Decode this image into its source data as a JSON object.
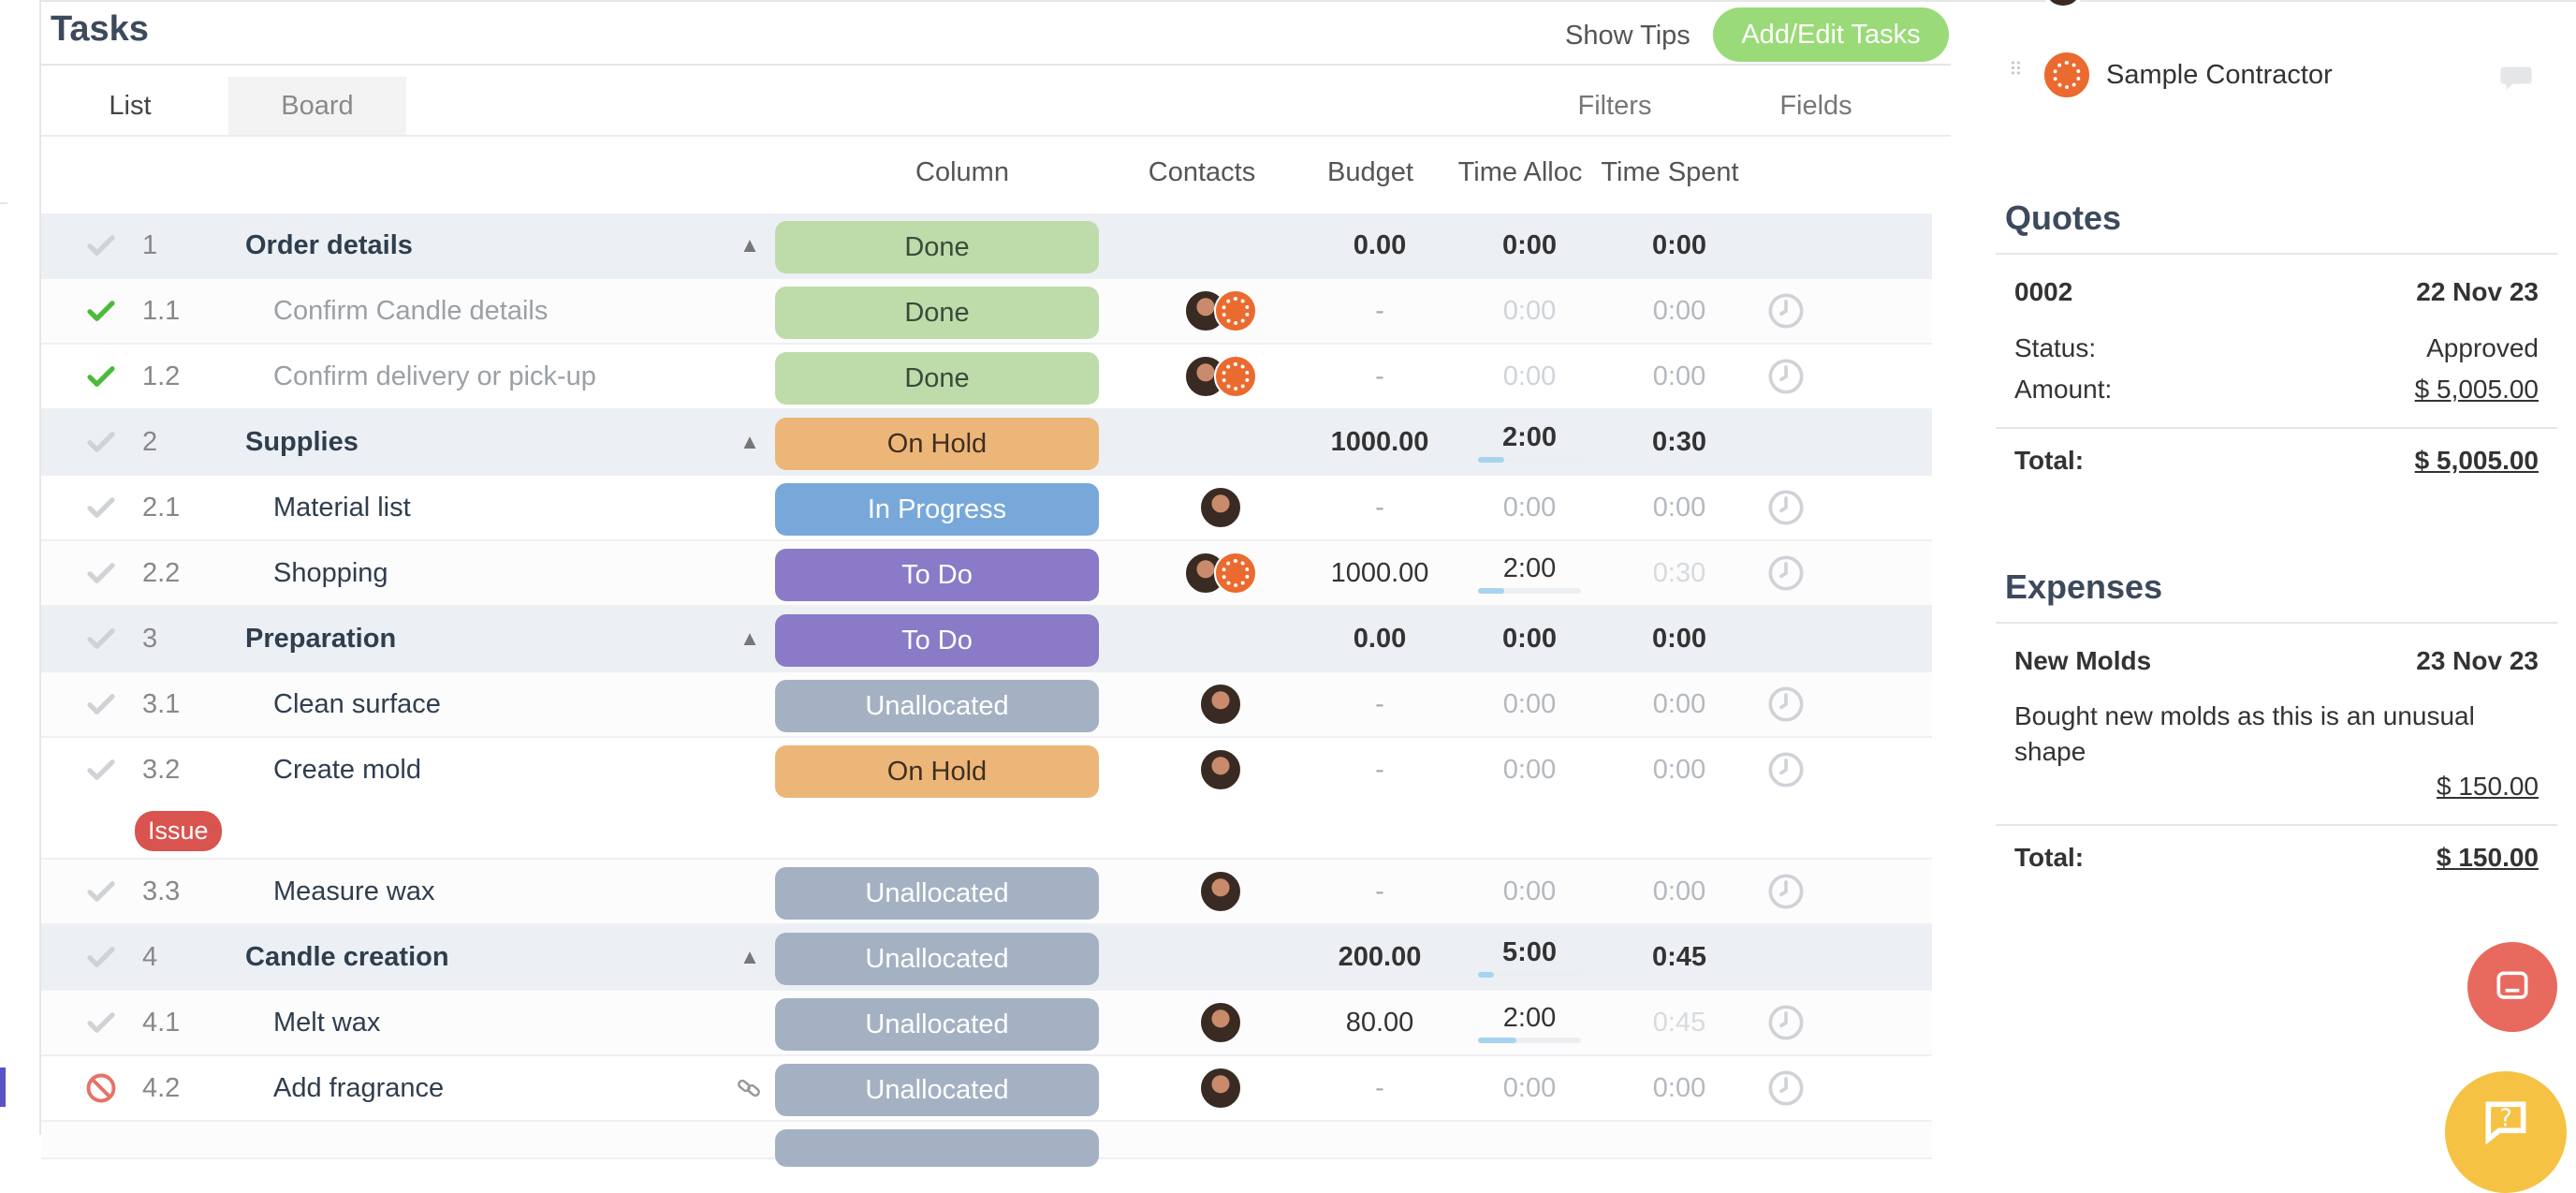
{
  "header": {
    "title": "Tasks",
    "show_tips": "Show Tips",
    "add_edit": "Add/Edit Tasks"
  },
  "tabs": {
    "list": "List",
    "board": "Board",
    "filters": "Filters",
    "fields": "Fields"
  },
  "columns": {
    "column": "Column",
    "contacts": "Contacts",
    "budget": "Budget",
    "time_alloc": "Time Alloc",
    "time_spent": "Time Spent"
  },
  "rows": [
    {
      "num": "1",
      "name": "Order details",
      "status": "Done",
      "budget": "0.00",
      "alloc": "0:00",
      "spent": "0:00"
    },
    {
      "num": "1.1",
      "name": "Confirm Candle details",
      "status": "Done",
      "budget": "-",
      "alloc": "0:00",
      "spent": "0:00"
    },
    {
      "num": "1.2",
      "name": "Confirm delivery or pick-up",
      "status": "Done",
      "budget": "-",
      "alloc": "0:00",
      "spent": "0:00"
    },
    {
      "num": "2",
      "name": "Supplies",
      "status": "On Hold",
      "budget": "1000.00",
      "alloc": "2:00",
      "spent": "0:30",
      "progress": 0.25
    },
    {
      "num": "2.1",
      "name": "Material list",
      "status": "In Progress",
      "budget": "-",
      "alloc": "0:00",
      "spent": "0:00"
    },
    {
      "num": "2.2",
      "name": "Shopping",
      "status": "To Do",
      "budget": "1000.00",
      "alloc": "2:00",
      "spent": "0:30",
      "progress": 0.25
    },
    {
      "num": "3",
      "name": "Preparation",
      "status": "To Do",
      "budget": "0.00",
      "alloc": "0:00",
      "spent": "0:00"
    },
    {
      "num": "3.1",
      "name": "Clean surface",
      "status": "Unallocated",
      "budget": "-",
      "alloc": "0:00",
      "spent": "0:00"
    },
    {
      "num": "3.2",
      "name": "Create mold",
      "status": "On Hold",
      "budget": "-",
      "alloc": "0:00",
      "spent": "0:00",
      "badge": "Issue"
    },
    {
      "num": "3.3",
      "name": "Measure wax",
      "status": "Unallocated",
      "budget": "-",
      "alloc": "0:00",
      "spent": "0:00"
    },
    {
      "num": "4",
      "name": "Candle creation",
      "status": "Unallocated",
      "budget": "200.00",
      "alloc": "5:00",
      "spent": "0:45",
      "progress": 0.15
    },
    {
      "num": "4.1",
      "name": "Melt wax",
      "status": "Unallocated",
      "budget": "80.00",
      "alloc": "2:00",
      "spent": "0:45",
      "progress": 0.375
    },
    {
      "num": "4.2",
      "name": "Add fragrance",
      "status": "Unallocated",
      "budget": "-",
      "alloc": "0:00",
      "spent": "0:00"
    }
  ],
  "contractor": {
    "name": "Sample Contractor"
  },
  "quotes": {
    "title": "Quotes",
    "number": "0002",
    "date": "22 Nov 23",
    "status_label": "Status:",
    "status_value": "Approved",
    "amount_label": "Amount:",
    "amount_value": "$ 5,005.00",
    "total_label": "Total:",
    "total_value": "$ 5,005.00"
  },
  "expenses": {
    "title": "Expenses",
    "name": "New Molds",
    "date": "23 Nov 23",
    "description": "Bought new molds as this is an unusual shape",
    "amount": "$ 150.00",
    "total_label": "Total:",
    "total_value": "$ 150.00"
  },
  "colors": {
    "done": "#bedcaa",
    "on_hold": "#edb679",
    "in_progress": "#78a8da",
    "to_do": "#8b7ac7",
    "unallocated": "#a4b1c3",
    "accent_green": "#9ada78",
    "issue": "#d9534f"
  }
}
